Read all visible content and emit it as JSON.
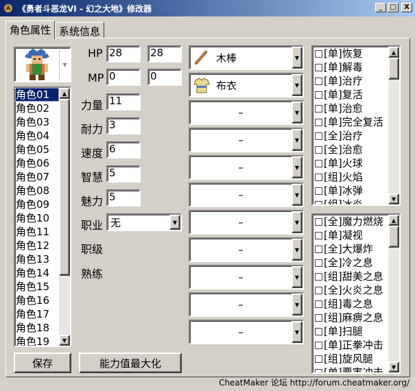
{
  "window": {
    "title": "《勇者斗恶龙VI - 幻之大地》修改器",
    "minimize": "_",
    "maximize": "□",
    "close": "X"
  },
  "tabs": [
    {
      "label": "角色属性",
      "active": true
    },
    {
      "label": "系统信息",
      "active": false
    }
  ],
  "characters": [
    "角色01",
    "角色02",
    "角色03",
    "角色04",
    "角色05",
    "角色06",
    "角色07",
    "角色08",
    "角色09",
    "角色10",
    "角色11",
    "角色12",
    "角色13",
    "角色14",
    "角色15",
    "角色16",
    "角色17",
    "角色18",
    "角色19"
  ],
  "selected_character": "角色01",
  "stats": {
    "hp_label": "HP",
    "hp_current": "28",
    "hp_max": "28",
    "mp_label": "MP",
    "mp_current": "0",
    "mp_max": "0",
    "strength_label": "力量",
    "strength": "11",
    "stamina_label": "耐力",
    "stamina": "3",
    "speed_label": "速度",
    "speed": "6",
    "wisdom_label": "智慧",
    "wisdom": "5",
    "charm_label": "魅力",
    "charm": "5",
    "job_label": "职业",
    "job": "无",
    "job_level_label": "职级",
    "proficiency_label": "熟练"
  },
  "equipment": [
    {
      "name": "木棒",
      "icon": "wooden-stick-icon"
    },
    {
      "name": "布衣",
      "icon": "cloth-armor-icon"
    },
    {
      "name": "–",
      "icon": ""
    },
    {
      "name": "–",
      "icon": ""
    },
    {
      "name": "–",
      "icon": ""
    },
    {
      "name": "–",
      "icon": ""
    },
    {
      "name": "–",
      "icon": ""
    },
    {
      "name": "–",
      "icon": ""
    },
    {
      "name": "–",
      "icon": ""
    },
    {
      "name": "–",
      "icon": ""
    },
    {
      "name": "–",
      "icon": ""
    }
  ],
  "spells": [
    "[单]恢复",
    "[单]解毒",
    "[单]治疗",
    "[单]复活",
    "[单]治愈",
    "[单]完全复活",
    "[全]治疗",
    "[全]治愈",
    "[单]火球",
    "[组]火焰",
    "[单]冰弹",
    "[组]冰炎"
  ],
  "skills": [
    "[全]魔力燃烧",
    "[单]凝视",
    "[全]大爆炸",
    "[全]冷之息",
    "[组]甜美之息",
    "[全]火炎之息",
    "[组]毒之息",
    "[组]麻痹之息",
    "[单]扫腿",
    "[单]正拳冲击",
    "[组]旋风腿",
    "[单]要害冲击"
  ],
  "buttons": {
    "save": "保存",
    "maximize_stats": "能力值最大化"
  },
  "footer": "CheatMaker 论坛 http://forum.cheatmaker.org/",
  "colors": {
    "titlebar_start": "#0a246a",
    "titlebar_end": "#a6caf0",
    "face": "#d4d0c8",
    "selection": "#0a246a"
  }
}
